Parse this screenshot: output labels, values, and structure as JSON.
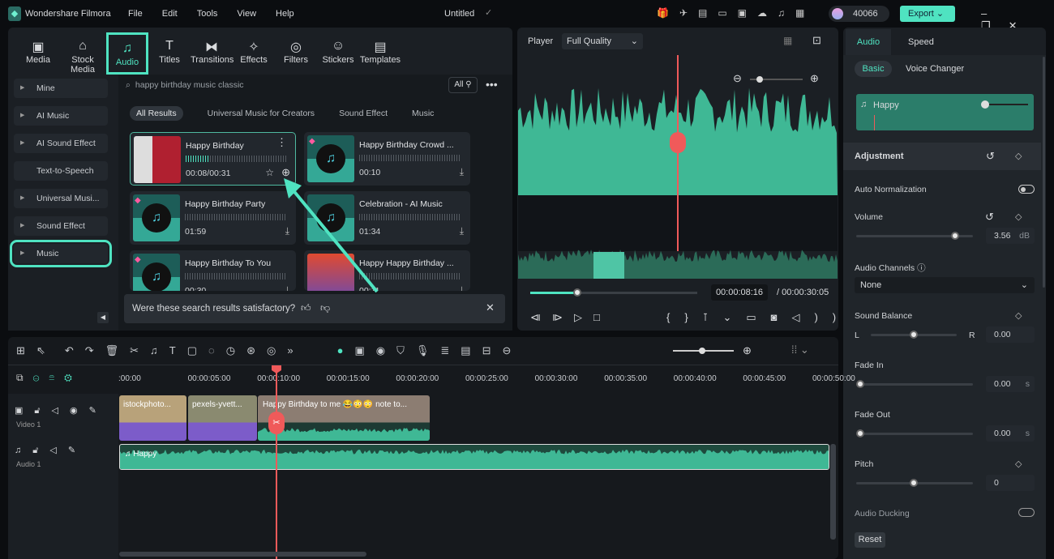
{
  "app": {
    "name": "Wondershare Filmora",
    "title": "Untitled",
    "menu": [
      "File",
      "Edit",
      "Tools",
      "View",
      "Help"
    ],
    "credits": "40066",
    "export_label": "Export"
  },
  "toolbar_tabs": [
    {
      "label": "Media",
      "icon": "media-icon"
    },
    {
      "label": "Stock Media",
      "icon": "stock-media-icon"
    },
    {
      "label": "Audio",
      "icon": "music-note-icon",
      "active": true
    },
    {
      "label": "Titles",
      "icon": "titles-icon"
    },
    {
      "label": "Transitions",
      "icon": "transitions-icon"
    },
    {
      "label": "Effects",
      "icon": "effects-icon"
    },
    {
      "label": "Filters",
      "icon": "filters-icon"
    },
    {
      "label": "Stickers",
      "icon": "stickers-icon"
    },
    {
      "label": "Templates",
      "icon": "templates-icon"
    }
  ],
  "sidebar": [
    "Mine",
    "AI Music",
    "AI Sound Effect",
    "Text-to-Speech",
    "Universal Musi...",
    "Sound Effect",
    "Music"
  ],
  "search": {
    "value": "happy birthday music classic",
    "filter": "All"
  },
  "filter_tabs": [
    "All Results",
    "Universal Music for Creators",
    "Sound Effect",
    "Music"
  ],
  "results": [
    {
      "title": "Happy Birthday",
      "time": "00:08/00:31",
      "selected": true
    },
    {
      "title": "Happy Birthday Crowd ...",
      "time": "00:10",
      "premium": true
    },
    {
      "title": "Happy Birthday Party",
      "time": "01:59",
      "premium": true
    },
    {
      "title": "Celebration - AI Music",
      "time": "01:34"
    },
    {
      "title": "Happy Birthday To You",
      "time": "00:30",
      "premium": true
    },
    {
      "title": "Happy Happy Birthday ...",
      "time": "00:11"
    }
  ],
  "feedback": "Were these search results satisfactory?",
  "player": {
    "label": "Player",
    "quality": "Full Quality",
    "current": "00:00:08:16",
    "total": "/ 00:00:30:05",
    "progress": 0.28
  },
  "right": {
    "tabs": [
      "Audio",
      "Speed"
    ],
    "subtabs": [
      "Basic",
      "Voice Changer"
    ],
    "clip_name": "Happy",
    "section": "Adjustment",
    "auto_normalization": "Auto Normalization",
    "auto_normalization_on": false,
    "volume": {
      "label": "Volume",
      "value": "3.56",
      "unit": "dB",
      "level": 0.85
    },
    "audio_channels": {
      "label": "Audio Channels",
      "value": "None"
    },
    "sound_balance": {
      "label": "Sound Balance",
      "value": "0.00",
      "l": "L",
      "r": "R",
      "level": 0.5
    },
    "fade_in": {
      "label": "Fade In",
      "value": "0.00",
      "unit": "s"
    },
    "fade_out": {
      "label": "Fade Out",
      "value": "0.00",
      "unit": "s"
    },
    "pitch": {
      "label": "Pitch",
      "value": "0"
    },
    "audio_ducking": "Audio Ducking",
    "reset": "Reset"
  },
  "timeline": {
    "ruler": [
      ":00:00",
      "00:00:05:00",
      "00:00:10:00",
      "00:00:15:00",
      "00:00:20:00",
      "00:00:25:00",
      "00:00:30:00",
      "00:00:35:00",
      "00:00:40:00",
      "00:00:45:00",
      "00:00:50:00"
    ],
    "tracks": {
      "video": "Video 1",
      "audio": "Audio 1"
    },
    "clips": [
      "istockphoto...",
      "pexels-yvett...",
      "Happy Birthday to me 😂😳😳 note to...",
      "Happy"
    ]
  },
  "colors": {
    "accent": "#4fe3c1",
    "playhead": "#f05a5a",
    "wave": "#3fb895"
  }
}
